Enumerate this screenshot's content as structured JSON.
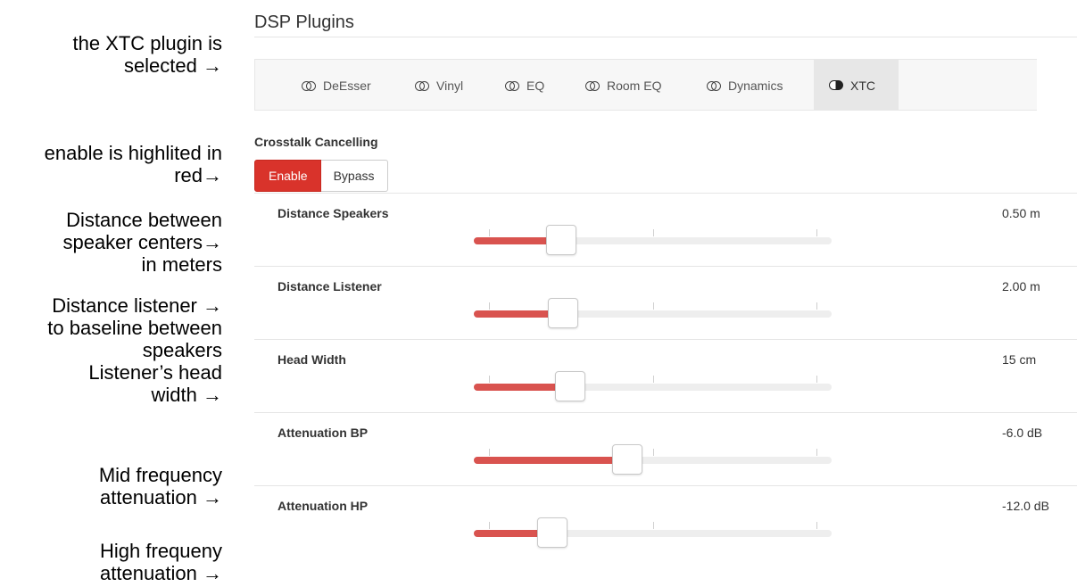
{
  "annotations": [
    {
      "lines": [
        "the XTC plugin is",
        "selected →"
      ]
    },
    {
      "lines": [
        "enable is highlited in",
        "red→"
      ]
    },
    {
      "lines": [
        "Distance between",
        "speaker centers→",
        "in meters"
      ]
    },
    {
      "lines": [
        "Distance listener →",
        "to baseline between",
        "speakers"
      ]
    },
    {
      "lines": [
        "Listener’s head",
        "width →"
      ]
    },
    {
      "lines": [
        "Mid frequency",
        "attenuation →"
      ]
    },
    {
      "lines": [
        "High frequeny",
        "attenuation →"
      ]
    }
  ],
  "page_title": "DSP Plugins",
  "tabs": [
    {
      "label": "DeEsser",
      "icon": "toggle-off-icon",
      "active": false
    },
    {
      "label": "Vinyl",
      "icon": "toggle-off-icon",
      "active": false
    },
    {
      "label": "EQ",
      "icon": "toggle-off-icon",
      "active": false
    },
    {
      "label": "Room EQ",
      "icon": "toggle-off-icon",
      "active": false
    },
    {
      "label": "Dynamics",
      "icon": "toggle-off-icon",
      "active": false
    },
    {
      "label": "XTC",
      "icon": "toggle-on-icon",
      "active": true
    }
  ],
  "section": {
    "title": "Crosstalk Cancelling",
    "enable_label": "Enable",
    "bypass_label": "Bypass",
    "accent_color": "#d9332b"
  },
  "sliders": [
    {
      "label": "Distance Speakers",
      "value": "0.50 m",
      "level": 0.245
    },
    {
      "label": "Distance Listener",
      "value": "2.00 m",
      "level": 0.25
    },
    {
      "label": "Head Width",
      "value": "15 cm",
      "level": 0.27
    },
    {
      "label": "Attenuation BP",
      "value": "-6.0 dB",
      "level": 0.43
    },
    {
      "label": "Attenuation HP",
      "value": "-12.0 dB",
      "level": 0.22
    }
  ]
}
